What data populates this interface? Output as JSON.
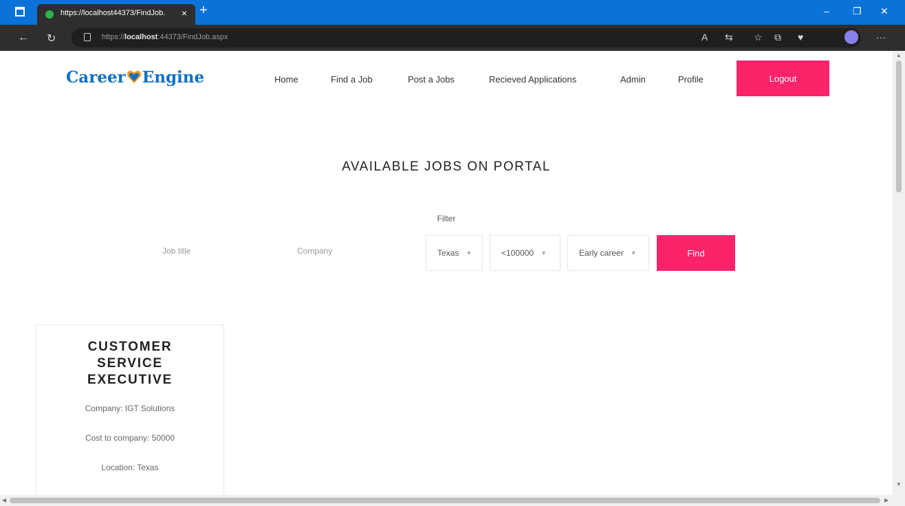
{
  "browser": {
    "tab_title": "https://localhost44373/FindJob.",
    "tab_close": "×",
    "new_tab": "+",
    "url_prefix": "https://",
    "url_host": "localhost",
    "url_rest": ":44373/FindJob.aspx",
    "window_minimize": "–",
    "window_restore": "❐",
    "window_close": "✕"
  },
  "site": {
    "logo_part1": "Career",
    "logo_part2": "Engine",
    "brand_color": "#0f6fc6",
    "accent_color": "#fb236a"
  },
  "nav": {
    "items": [
      {
        "label": "Home"
      },
      {
        "label": "Find a Job"
      },
      {
        "label": "Post a Jobs"
      },
      {
        "label": "Recieved Applications"
      },
      {
        "label": "Admin"
      },
      {
        "label": "Profile"
      }
    ],
    "logout_label": "Logout"
  },
  "main": {
    "title": "AVAILABLE JOBS ON PORTAL",
    "filter_label": "Filter",
    "job_title_placeholder": "Job title",
    "company_placeholder": "Company",
    "location_value": "Texas",
    "salary_value": "<100000",
    "experience_value": "Early career",
    "find_label": "Find"
  },
  "jobs": [
    {
      "title_line1": "CUSTOMER",
      "title_line2": "SERVICE",
      "title_line3": "EXECUTIVE",
      "company": "Company: IGT Solutions",
      "ctc": "Cost to company: 50000",
      "location": "Location: Texas"
    }
  ]
}
